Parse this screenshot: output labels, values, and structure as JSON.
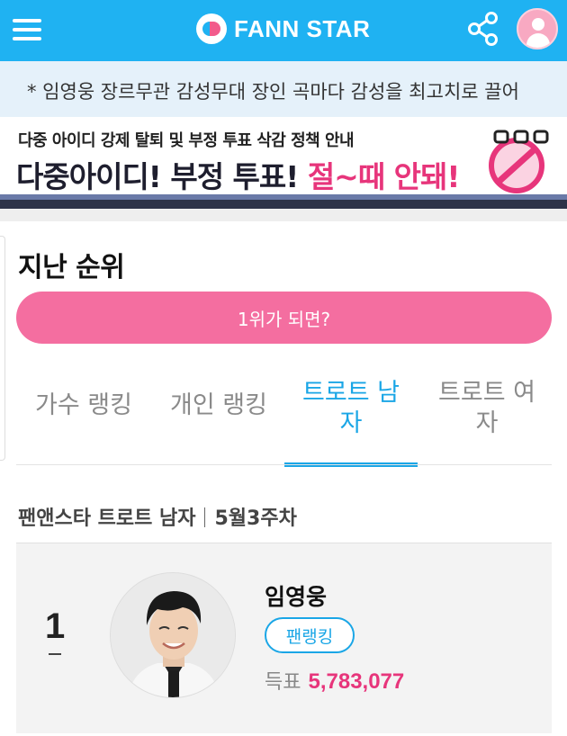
{
  "header": {
    "logo_text": "FANN STAR",
    "menu_icon": "hamburger-menu-icon",
    "share_icon": "share-icon",
    "profile_icon": "user-avatar-icon",
    "brand_color": "#1fb2f2",
    "accent_color": "#f46ea0"
  },
  "notice": {
    "text": "* 임영웅 장르무관 감성무대 장인 곡마다 감성을 최고치로 끌어"
  },
  "banner": {
    "subtitle": "다중 아이디 강제 탈퇴 및 부정 투표 삭감 정책 안내",
    "headline_dark": "다중아이디! 부정 투표! ",
    "headline_pink": "절~때 안돼!",
    "icon": "no-entry-icon"
  },
  "ranking": {
    "section_title": "지난 순위",
    "become_first_label": "1위가 되면?",
    "tabs": [
      {
        "line1": "가수 랭킹",
        "line2": ""
      },
      {
        "line1": "개인 랭킹",
        "line2": ""
      },
      {
        "line1": "트로트 남",
        "line2": "자"
      },
      {
        "line1": "트로트 여",
        "line2": "자"
      }
    ],
    "active_tab": 2,
    "week_category": "팬앤스타 트로트 남자",
    "week_label": "5월3주차",
    "entries": [
      {
        "rank": "1",
        "change": "–",
        "name": "임영웅",
        "badge": "팬랭킹",
        "votes_label": "득표",
        "votes": "5,783,077"
      }
    ]
  }
}
